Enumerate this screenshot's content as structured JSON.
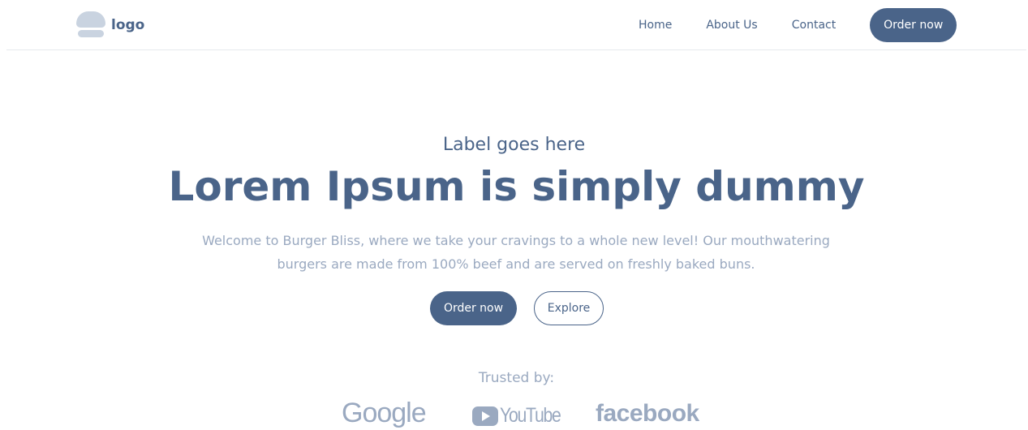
{
  "header": {
    "logo_text": "logo",
    "nav": [
      {
        "label": "Home"
      },
      {
        "label": "About Us"
      },
      {
        "label": "Contact"
      }
    ],
    "cta_label": "Order now"
  },
  "hero": {
    "label": "Label goes here",
    "title": "Lorem Ipsum is simply dummy",
    "description": "Welcome to Burger Bliss, where we take your cravings to a whole new level! Our mouthwatering burgers are made from 100% beef and are served on freshly baked buns.",
    "primary_button": "Order now",
    "secondary_button": "Explore"
  },
  "trusted": {
    "label": "Trusted by:",
    "brands": [
      "Google",
      "YouTube",
      "facebook"
    ]
  },
  "colors": {
    "primary": "#4a6489",
    "muted": "#9aa9c0",
    "logo_mark": "#c9d3e0"
  }
}
